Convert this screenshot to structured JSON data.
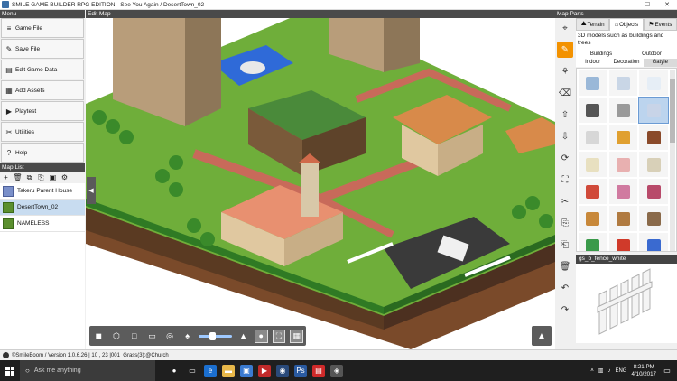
{
  "window": {
    "title": "SMILE GAME BUILDER RPG EDITION - See You Again / DesertTown_02",
    "minimize": "—",
    "maximize": "☐",
    "close": "✕"
  },
  "menu": {
    "header": "Menu",
    "items": [
      {
        "label": "Game File",
        "icon": "database-icon",
        "glyph": "≡"
      },
      {
        "label": "Save File",
        "icon": "save-icon",
        "glyph": "✎"
      },
      {
        "label": "Edit Game Data",
        "icon": "edit-data-icon",
        "glyph": "▤"
      },
      {
        "label": "Add Assets",
        "icon": "assets-icon",
        "glyph": "▦"
      },
      {
        "label": "Playtest",
        "icon": "play-icon",
        "glyph": "▶"
      },
      {
        "label": "Utilities",
        "icon": "wrench-icon",
        "glyph": "✂"
      },
      {
        "label": "Help",
        "icon": "help-icon",
        "glyph": "?"
      }
    ]
  },
  "map_list": {
    "header": "Map List",
    "tools": [
      "+",
      "🗑",
      "⧉",
      "⎘",
      "▣",
      "⚙"
    ],
    "items": [
      {
        "label": "Takeru Parent House",
        "selected": false
      },
      {
        "label": "DesertTown_02",
        "selected": true
      },
      {
        "label": "NAMELESS",
        "selected": false
      }
    ]
  },
  "edit_map": {
    "header": "Edit Map",
    "collapse_glyph": "◀",
    "corner_glyph": "▲"
  },
  "map_parts": {
    "header": "Map Parts",
    "tabs": [
      {
        "label": "Terrain",
        "glyph": "⛰",
        "active": false
      },
      {
        "label": "Objects",
        "glyph": "⌂",
        "active": true
      },
      {
        "label": "Events",
        "glyph": "⚑",
        "active": false
      }
    ],
    "description": "3D models such as buildings and trees",
    "categories": [
      {
        "label": "Buildings",
        "active": false
      },
      {
        "label": "Outdoor",
        "active": false
      },
      {
        "label": "Indoor",
        "active": false
      },
      {
        "label": "Decoration",
        "active": false
      },
      {
        "label": "Gatyle",
        "active": true
      }
    ],
    "selected_part_name": "gs_b_fence_white",
    "colors": [
      "#9ab8d8",
      "#c9d6e6",
      "#e6eef6",
      "#555555",
      "#9a9a9a",
      "#c8d4e8",
      "#d7d7d7",
      "#e0a030",
      "#8a4a2a",
      "#e8e0c0",
      "#e8b0b0",
      "#d8d0b8",
      "#d04a3a",
      "#d07aa0",
      "#b84a6a",
      "#c8883a",
      "#b07a40",
      "#8a6a4a",
      "#3a9a4a",
      "#d03a2a",
      "#3a6ad0"
    ]
  },
  "tools": [
    "⌖",
    "✎",
    "⚘",
    "⌫",
    "⇧",
    "⇩",
    "⟳",
    "⛶",
    "✂",
    "⎘",
    "⎗",
    "🗑",
    "↶",
    "↷"
  ],
  "status": {
    "text": "©SmileBoom / Version 1.0.6.26 | 10 , 23 |001_Grass(3):@Church"
  },
  "taskbar": {
    "search_placeholder": "Ask me anything",
    "time": "8:21 PM",
    "date": "4/10/2017",
    "lang": "ENG"
  }
}
